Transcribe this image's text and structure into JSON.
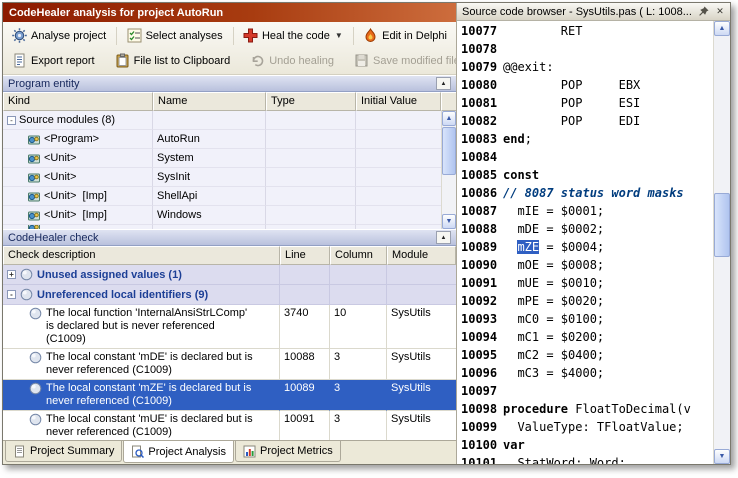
{
  "window_title": "CodeHealer analysis for project AutoRun",
  "toolbar": {
    "row1": [
      {
        "label": "Analyse project"
      },
      {
        "label": "Select analyses"
      },
      {
        "label": "Heal the code"
      },
      {
        "label": "Edit in Delphi"
      }
    ],
    "row2": [
      {
        "label": "Export report"
      },
      {
        "label": "File list to Clipboard"
      },
      {
        "label": "Undo healing",
        "disabled": true
      },
      {
        "label": "Save modified file",
        "disabled": true
      }
    ]
  },
  "program_entity": {
    "title": "Program entity",
    "columns": [
      "Kind",
      "Name",
      "Type",
      "Initial Value"
    ],
    "rows": [
      {
        "kind": "Source modules (8)",
        "name": "",
        "type": "",
        "initial": "",
        "expander": "-",
        "level": 0
      },
      {
        "kind": "<Program>",
        "name": "AutoRun",
        "type": "",
        "initial": "",
        "level": 1,
        "icon": "unit"
      },
      {
        "kind": "<Unit>",
        "name": "System",
        "type": "",
        "initial": "",
        "level": 1,
        "icon": "unit"
      },
      {
        "kind": "<Unit>",
        "name": "SysInit",
        "type": "",
        "initial": "",
        "level": 1,
        "icon": "unit"
      },
      {
        "kind": "<Unit>  [Imp]",
        "name": "ShellApi",
        "type": "",
        "initial": "",
        "level": 1,
        "icon": "unit"
      },
      {
        "kind": "<Unit>  [Imp]",
        "name": "Windows",
        "type": "",
        "initial": "",
        "level": 1,
        "icon": "unit"
      },
      {
        "kind": "",
        "name": "",
        "type": "",
        "initial": "",
        "level": 1,
        "icon": "unit",
        "partial": true
      }
    ]
  },
  "check_panel": {
    "title": "CodeHealer check",
    "columns": [
      "Check description",
      "Line",
      "Column",
      "Module"
    ],
    "rows": [
      {
        "type": "group",
        "expander": "+",
        "desc": "Unused assigned values (1)",
        "line": "",
        "column": "",
        "module": ""
      },
      {
        "type": "group",
        "expander": "-",
        "desc": "Unreferenced local identifiers (9)",
        "line": "",
        "column": "",
        "module": ""
      },
      {
        "type": "item",
        "desc": "The local function 'InternalAnsiStrLComp' is declared but is never referenced (C1009)",
        "line": "3740",
        "column": "10",
        "module": "SysUtils"
      },
      {
        "type": "item",
        "desc": "The local constant 'mDE' is declared but is never referenced (C1009)",
        "line": "10088",
        "column": "3",
        "module": "SysUtils"
      },
      {
        "type": "item",
        "selected": true,
        "desc": "The local constant 'mZE' is declared but is never referenced (C1009)",
        "line": "10089",
        "column": "3",
        "module": "SysUtils"
      },
      {
        "type": "item",
        "desc": "The local constant 'mUE' is declared but is never referenced (C1009)",
        "line": "10091",
        "column": "3",
        "module": "SysUtils"
      }
    ]
  },
  "tabs": [
    {
      "label": "Project Summary",
      "active": false
    },
    {
      "label": "Project Analysis",
      "active": true
    },
    {
      "label": "Project Metrics",
      "active": false
    }
  ],
  "source_browser": {
    "title": "Source code browser - SysUtils.pas ( L: 1008...",
    "selection_color": "#2f5fc2",
    "lines": [
      {
        "n": "10077",
        "s": [
          {
            "t": "        RET"
          }
        ]
      },
      {
        "n": "10078",
        "s": []
      },
      {
        "n": "10079",
        "s": [
          {
            "t": "@@exit:"
          }
        ]
      },
      {
        "n": "10080",
        "s": [
          {
            "t": "        POP     EBX"
          }
        ]
      },
      {
        "n": "10081",
        "s": [
          {
            "t": "        POP     ESI"
          }
        ]
      },
      {
        "n": "10082",
        "s": [
          {
            "t": "        POP     EDI"
          }
        ]
      },
      {
        "n": "10083",
        "s": [
          {
            "t": "end",
            "c": "kw"
          },
          {
            "t": ";"
          }
        ]
      },
      {
        "n": "10084",
        "s": []
      },
      {
        "n": "10085",
        "s": [
          {
            "t": "const",
            "c": "kw"
          }
        ]
      },
      {
        "n": "10086",
        "s": [
          {
            "t": "// 8087 status word masks",
            "c": "comment"
          }
        ]
      },
      {
        "n": "10087",
        "s": [
          {
            "t": "  mIE = $0001;"
          }
        ]
      },
      {
        "n": "10088",
        "s": [
          {
            "t": "  mDE = $0002;"
          }
        ]
      },
      {
        "n": "10089",
        "s": [
          {
            "t": "  "
          },
          {
            "t": "mZE",
            "c": "sel"
          },
          {
            "t": " = $0004;"
          }
        ]
      },
      {
        "n": "10090",
        "s": [
          {
            "t": "  mOE = $0008;"
          }
        ]
      },
      {
        "n": "10091",
        "s": [
          {
            "t": "  mUE = $0010;"
          }
        ]
      },
      {
        "n": "10092",
        "s": [
          {
            "t": "  mPE = $0020;"
          }
        ]
      },
      {
        "n": "10093",
        "s": [
          {
            "t": "  mC0 = $0100;"
          }
        ]
      },
      {
        "n": "10094",
        "s": [
          {
            "t": "  mC1 = $0200;"
          }
        ]
      },
      {
        "n": "10095",
        "s": [
          {
            "t": "  mC2 = $0400;"
          }
        ]
      },
      {
        "n": "10096",
        "s": [
          {
            "t": "  mC3 = $4000;"
          }
        ]
      },
      {
        "n": "10097",
        "s": []
      },
      {
        "n": "10098",
        "s": [
          {
            "t": "procedure",
            "c": "kw"
          },
          {
            "t": " FloatToDecimal(v"
          }
        ]
      },
      {
        "n": "10099",
        "s": [
          {
            "t": "  ValueType: TFloatValue;"
          }
        ]
      },
      {
        "n": "10100",
        "s": [
          {
            "t": "var",
            "c": "kw"
          }
        ]
      },
      {
        "n": "10101",
        "s": [
          {
            "t": "  StatWord: Word;"
          }
        ]
      }
    ]
  },
  "colors": {
    "selection": "#2f5fc2",
    "titlebar": "#8c1a00",
    "panel_header": "#b9c1dd",
    "group_row": "#dcdcef"
  }
}
